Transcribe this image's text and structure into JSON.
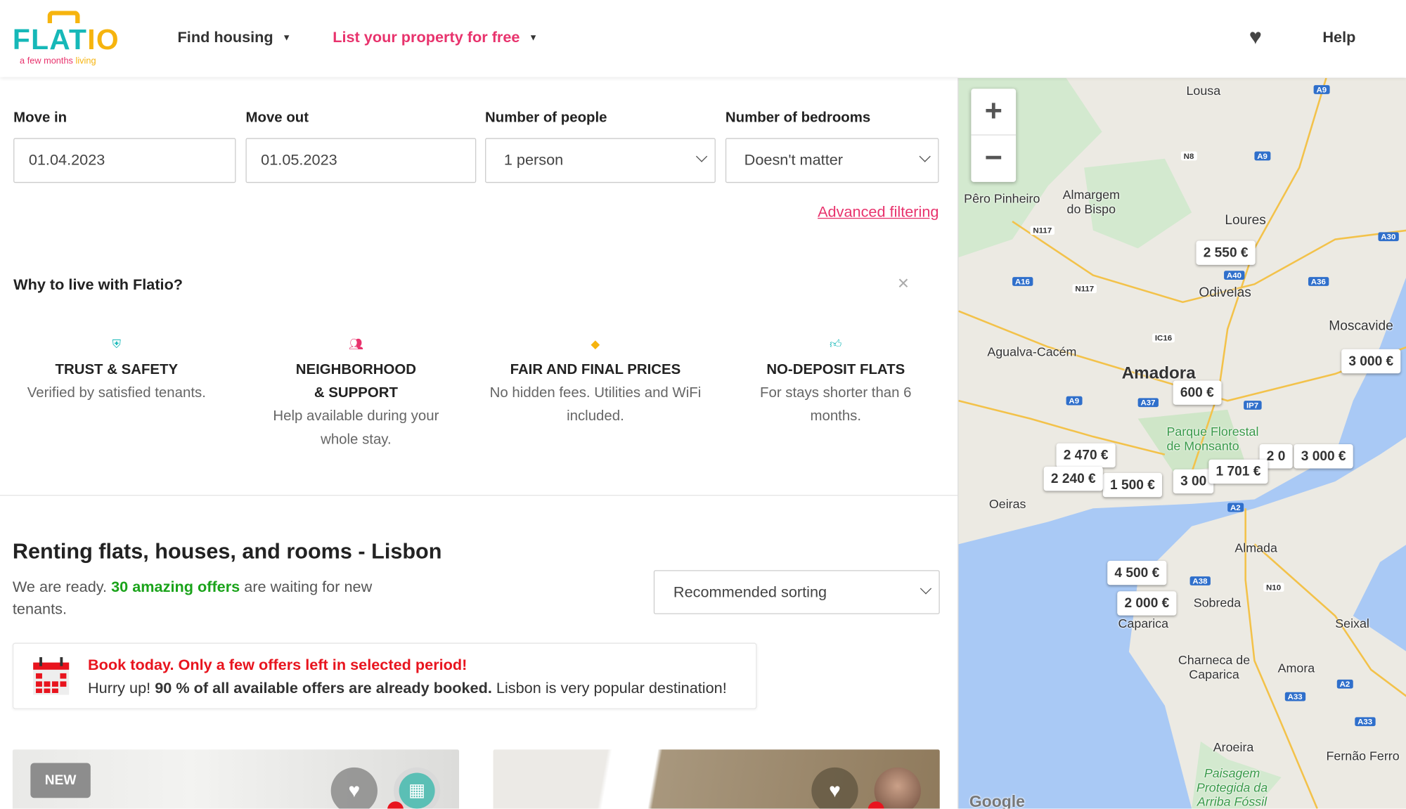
{
  "header": {
    "logo": "FLATIO",
    "tagline_a": "a few months",
    "tagline_b": "living",
    "find_housing": "Find housing",
    "list_property": "List your property for free",
    "help": "Help",
    "favorites_icon": "heart-icon"
  },
  "search": {
    "move_in_label": "Move in",
    "move_in_value": "01.04.2023",
    "move_out_label": "Move out",
    "move_out_value": "01.05.2023",
    "people_label": "Number of people",
    "people_value": "1 person",
    "bedrooms_label": "Number of bedrooms",
    "bedrooms_value": "Doesn't matter",
    "advanced": "Advanced filtering"
  },
  "why": {
    "title": "Why to live with Flatio?",
    "features": [
      {
        "icon": "shield-icon",
        "title": "TRUST & SAFETY",
        "text": "Verified by satisfied tenants."
      },
      {
        "icon": "people-icon",
        "title_1": "NEIGHBORHOOD",
        "title_2": "& SUPPORT",
        "text": "Help available during your whole stay."
      },
      {
        "icon": "tag-icon",
        "title": "FAIR AND FINAL PRICES",
        "text": "No hidden fees. Utilities and WiFi included."
      },
      {
        "icon": "thumbs-up-icon",
        "title": "NO-DEPOSIT FLATS",
        "text": "For stays shorter than 6 months."
      }
    ]
  },
  "listing": {
    "title": "Renting flats, houses, and rooms - Lisbon",
    "intro_a": "We are ready. ",
    "offers": "30 amazing offers",
    "intro_b": " are waiting for new tenants.",
    "sort": "Recommended sorting"
  },
  "alert": {
    "title": "Book today. Only a few offers left in selected period!",
    "text_a": "Hurry up! ",
    "text_bold": "90 % of all available offers are already booked.",
    "text_b": " Lisbon is very popular destination!"
  },
  "cards": [
    {
      "badge": "NEW"
    },
    {}
  ],
  "colors": {
    "teal": "#16b8b8",
    "pink": "#e8336d",
    "yellow": "#f6b40e",
    "green": "#1aa31a",
    "red": "#e8141e",
    "water": "#a9c9f5"
  },
  "map": {
    "zoom_in": "+",
    "zoom_out": "−",
    "prices": [
      "2 550 €",
      "3 000 €",
      "600 €",
      "2 470 €",
      "2 240 €",
      "1 500 €",
      "3 00",
      "1 701 €",
      "2 0",
      "3 000 €",
      "4 500 €",
      "2 000 €"
    ],
    "places": [
      "Lousa",
      "Loures",
      "Odivelas",
      "Amadora",
      "Moscavide",
      "Pêro Pinheiro",
      "Almargem do Bispo",
      "Agualva-Cacém",
      "Oeiras",
      "Almada",
      "Sobreda",
      "Seixal",
      "Amora",
      "Charneca de Caparica",
      "Aroeira",
      "Fernão Ferro",
      "Caparica",
      "Parque Florestal de Monsanto",
      "Paisagem Protegida da Arriba Fóssil",
      "Google"
    ],
    "roads": [
      "A9",
      "N8",
      "A9",
      "A30",
      "N117",
      "A16",
      "N117",
      "A40",
      "A36",
      "IC16",
      "A9",
      "A37",
      "IP7",
      "A2",
      "A38",
      "N10",
      "A2",
      "A33",
      "A33"
    ]
  }
}
